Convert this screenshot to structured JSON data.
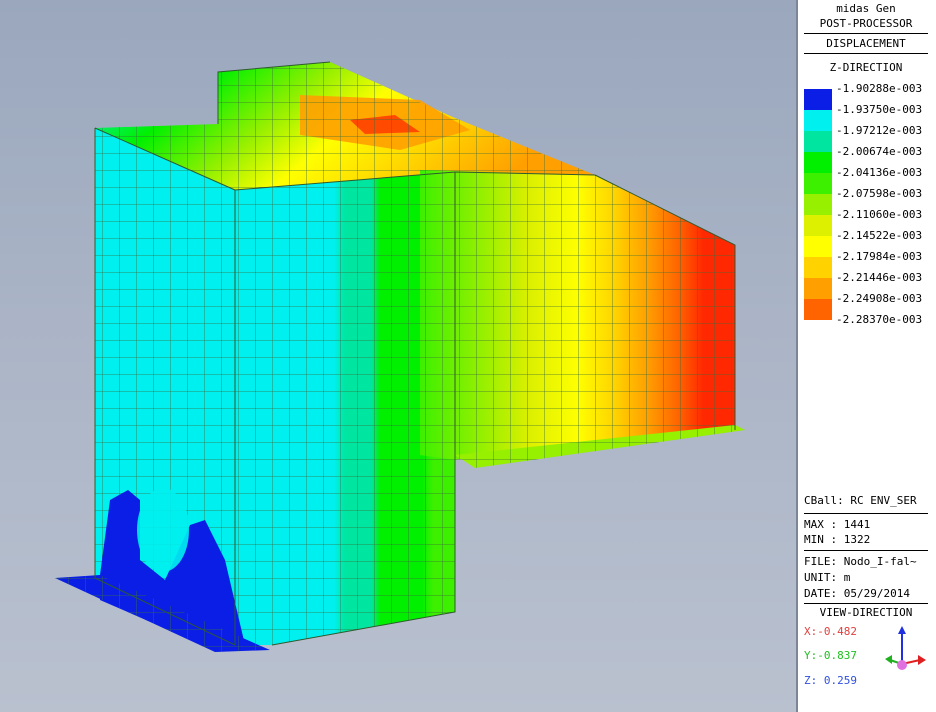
{
  "panel": {
    "app_name": "midas Gen",
    "module": "POST-PROCESSOR",
    "result_type": "DISPLACEMENT",
    "direction": "Z-DIRECTION",
    "legend": [
      {
        "label": "-1.90288e-003",
        "color": "#0a1ee6"
      },
      {
        "label": "-1.93750e-003",
        "color": "#00f0f0"
      },
      {
        "label": "-1.97212e-003",
        "color": "#00e6a0"
      },
      {
        "label": "-2.00674e-003",
        "color": "#00f000"
      },
      {
        "label": "-2.04136e-003",
        "color": "#3cf000"
      },
      {
        "label": "-2.07598e-003",
        "color": "#96f000"
      },
      {
        "label": "-2.11060e-003",
        "color": "#dcf000"
      },
      {
        "label": "-2.14522e-003",
        "color": "#ffff00"
      },
      {
        "label": "-2.17984e-003",
        "color": "#ffd200"
      },
      {
        "label": "-2.21446e-003",
        "color": "#ffa000"
      },
      {
        "label": "-2.24908e-003",
        "color": "#ff6400"
      },
      {
        "label": "-2.28370e-003",
        "color": "#ff2800"
      }
    ],
    "load_case": "CBall: RC ENV_SER",
    "max": "MAX : 1441",
    "min": "MIN : 1322",
    "file": "FILE: Nodo_I-fal~",
    "unit": "UNIT: m",
    "date": "DATE: 05/29/2014",
    "view_direction": "VIEW-DIRECTION",
    "vx": "X:-0.482",
    "vy": "Y:-0.837",
    "vz": "Z: 0.259",
    "vx_color": "#e04040",
    "vy_color": "#20c020",
    "vz_color": "#3050e0"
  }
}
